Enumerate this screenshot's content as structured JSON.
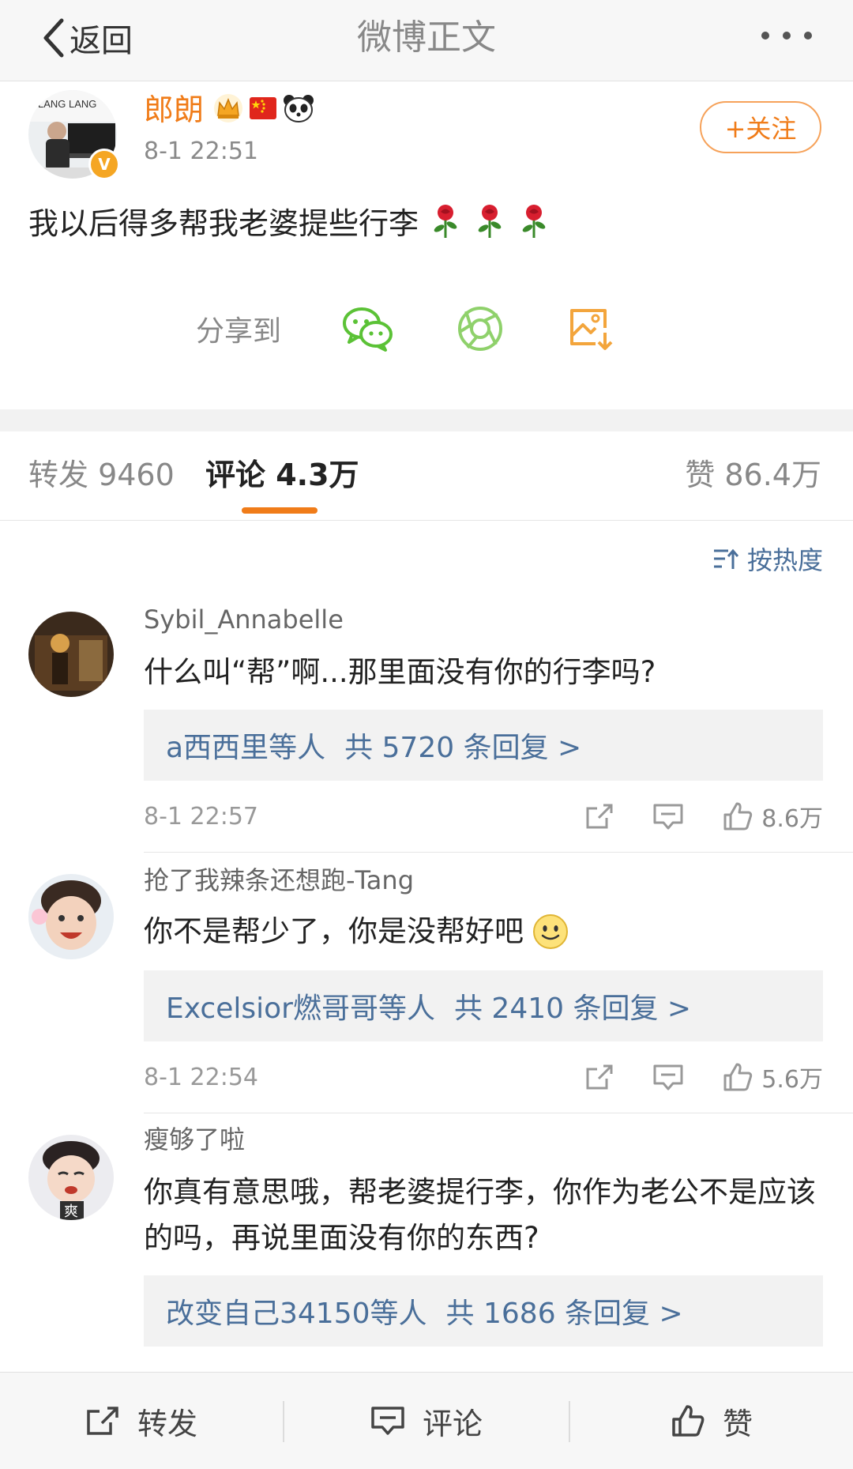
{
  "nav": {
    "back_label": "返回",
    "title": "微博正文"
  },
  "post": {
    "author": "郎朗",
    "time": "8-1 22:51",
    "follow_label": "+关注",
    "text": "我以后得多帮我老婆提些行李",
    "emoji": [
      "rose-icon",
      "rose-icon",
      "rose-icon"
    ],
    "badges": [
      "crown-icon",
      "china-flag-icon",
      "panda-icon"
    ],
    "avatar_logo_text": "LANG LANG",
    "share_label": "分享到"
  },
  "tabs": {
    "repost": "转发 9460",
    "comment": "评论 4.3万",
    "like": "赞 86.4万"
  },
  "sort_label": "按热度",
  "comments": [
    {
      "name": "Sybil_Annabelle",
      "text": "什么叫“帮”啊...那里面没有你的行李吗?",
      "reply_who": "a西西里",
      "reply_suffix": "等人",
      "reply_total": "共 5720 条回复 >",
      "time": "8-1 22:57",
      "likes": "8.6万"
    },
    {
      "name": "抢了我辣条还想跑-Tang",
      "text": "你不是帮少了，你是没帮好吧",
      "reply_who": "Excelsior燃哥哥",
      "reply_suffix": "等人",
      "reply_total": "共 2410 条回复 >",
      "time": "8-1 22:54",
      "likes": "5.6万"
    },
    {
      "name": "瘦够了啦",
      "text": "你真有意思哦，帮老婆提行李，你作为老公不是应该的吗，再说里面没有你的东西?",
      "reply_who": "改变自己34150",
      "reply_suffix": "等人",
      "reply_total": "共 1686 条回复 >",
      "avatar_text": "爽"
    }
  ],
  "bottom": {
    "repost": "转发",
    "comment": "评论",
    "like": "赞"
  },
  "colors": {
    "accent_orange": "#f07c19",
    "link_blue": "#4a6f9a",
    "wechat_green": "#5bc236",
    "moments_green": "#8fd16b",
    "save_orange": "#f3a53c"
  }
}
